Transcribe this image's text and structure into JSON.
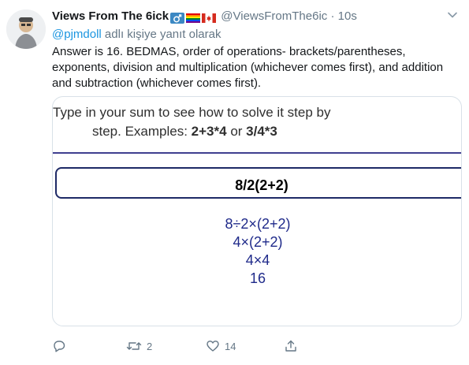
{
  "tweet": {
    "author_name": "Views From The 6ick",
    "handle": "@ViewsFromThe6ic",
    "separator": "·",
    "time": "10s",
    "reply_to": {
      "mention": "@pjmdoll",
      "suffix": "adlı kişiye yanıt olarak"
    },
    "text": "Answer is 16. BEDMAS, order of operations- brackets/parentheses, exponents, division and multiplication (whichever comes first), and addition and subtraction (whichever comes first).",
    "icons": {
      "badges": [
        "male-sign-icon",
        "rainbow-flag-icon",
        "canada-flag-icon"
      ],
      "menu": "chevron-down-icon"
    },
    "media": {
      "hint_line1": "Type in your sum to see how to solve it step by",
      "hint_line2_prefix": "step. Examples: ",
      "example1": "2+3*4",
      "hint_or": " or ",
      "example2": "3/4*3",
      "input_value": "8/2(2+2)",
      "steps": [
        "8÷2×(2+2)",
        "4×(2+2)",
        "4×4",
        "16"
      ]
    },
    "actions": {
      "reply_count": "",
      "retweet_count": "2",
      "like_count": "14",
      "share_count": ""
    }
  },
  "colors": {
    "link": "#1b95e0",
    "muted": "#657786",
    "steps": "#1f2a8a",
    "rule": "#3f3f8f"
  }
}
